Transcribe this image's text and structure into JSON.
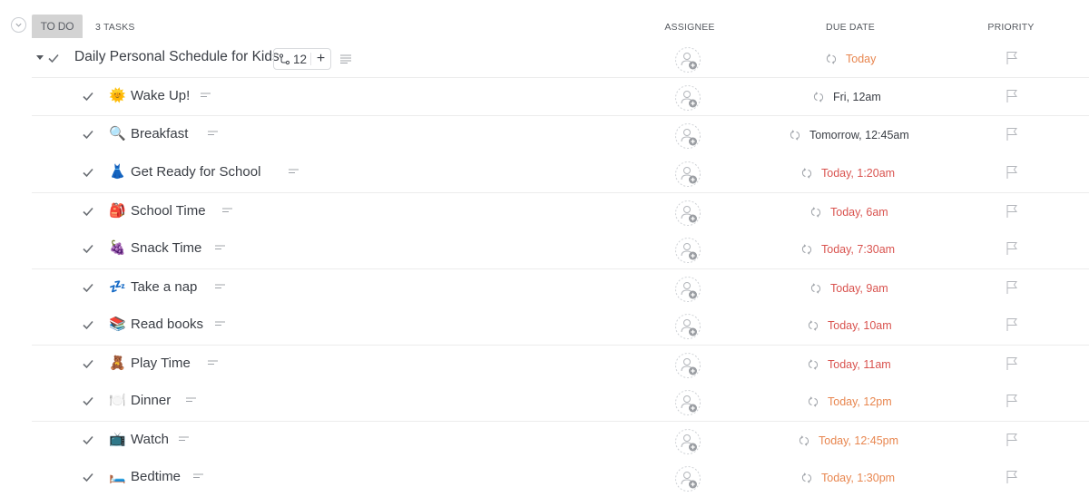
{
  "header": {
    "status_label": "TO DO",
    "task_count": "3 TASKS",
    "columns": {
      "assignee": "ASSIGNEE",
      "due_date": "DUE DATE",
      "priority": "PRIORITY"
    }
  },
  "colors": {
    "overdue": "#d9534f",
    "upcoming": "#e8864f",
    "normal": "#3a3e45"
  },
  "parent_task": {
    "name": "Daily Personal Schedule for Kids",
    "subtask_count": "12",
    "add_label": "+",
    "due": "Today",
    "due_status": "upcoming",
    "icons": {
      "subtasks": "subtask-branch-icon",
      "description": "description-lines-icon",
      "recurring": "recurring-icon",
      "assignee": "add-assignee-icon",
      "priority": "flag-icon"
    }
  },
  "subtasks": [
    {
      "emoji": "🌞",
      "emoji_name": "sun-with-face-icon",
      "name": "Wake Up!",
      "due": "Fri, 12am",
      "due_status": "normal"
    },
    {
      "emoji": "🔍",
      "emoji_name": "magnifying-glass-icon",
      "name": "Breakfast",
      "due": "Tomorrow, 12:45am",
      "due_status": "normal"
    },
    {
      "emoji": "👗",
      "emoji_name": "dress-icon",
      "name": "Get Ready for School",
      "due": "Today, 1:20am",
      "due_status": "overdue"
    },
    {
      "emoji": "🎒",
      "emoji_name": "backpack-icon",
      "name": "School Time",
      "due": "Today, 6am",
      "due_status": "overdue"
    },
    {
      "emoji": "🍇",
      "emoji_name": "grapes-icon",
      "name": "Snack Time",
      "due": "Today, 7:30am",
      "due_status": "overdue"
    },
    {
      "emoji": "💤",
      "emoji_name": "zzz-icon",
      "name": "Take a nap",
      "due": "Today, 9am",
      "due_status": "overdue"
    },
    {
      "emoji": "📚",
      "emoji_name": "books-icon",
      "name": "Read books",
      "due": "Today, 10am",
      "due_status": "overdue"
    },
    {
      "emoji": "🧸",
      "emoji_name": "teddy-bear-icon",
      "name": "Play Time",
      "due": "Today, 11am",
      "due_status": "overdue"
    },
    {
      "emoji": "🍽️",
      "emoji_name": "plate-icon",
      "name": "Dinner",
      "due": "Today, 12pm",
      "due_status": "upcoming"
    },
    {
      "emoji": "📺",
      "emoji_name": "television-icon",
      "name": "Watch",
      "due": "Today, 12:45pm",
      "due_status": "upcoming"
    },
    {
      "emoji": "🛏️",
      "emoji_name": "bed-icon",
      "name": "Bedtime",
      "due": "Today, 1:30pm",
      "due_status": "upcoming"
    }
  ]
}
